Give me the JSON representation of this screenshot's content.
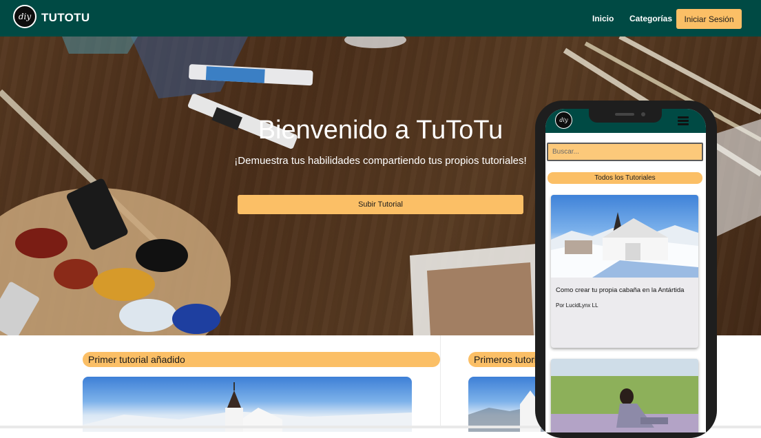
{
  "nav": {
    "logo_text": "diy",
    "brand": "TUTOTU",
    "links": [
      "Inicio",
      "Categorías"
    ],
    "login_label": "Iniciar Sesión"
  },
  "hero": {
    "title": "Bienvenido a TuToTu",
    "subtitle": "¡Demuestra tus habilidades compartiendo tus propios tutoriales!",
    "upload_label": "Subir Tutorial"
  },
  "sections": [
    {
      "title": "Primer tutorial añadido"
    },
    {
      "title": "Primeros tutoriales"
    }
  ],
  "phone": {
    "logo_text": "diy",
    "search_placeholder": "Buscar...",
    "section_title": "Todos los Tutoriales",
    "cards": [
      {
        "title": "Como crear tu propia cabaña en la Antártida",
        "author": "Por LucidLynx LL"
      }
    ]
  },
  "colors": {
    "header_green": "#004a44",
    "accent_orange": "#fbbf66"
  }
}
